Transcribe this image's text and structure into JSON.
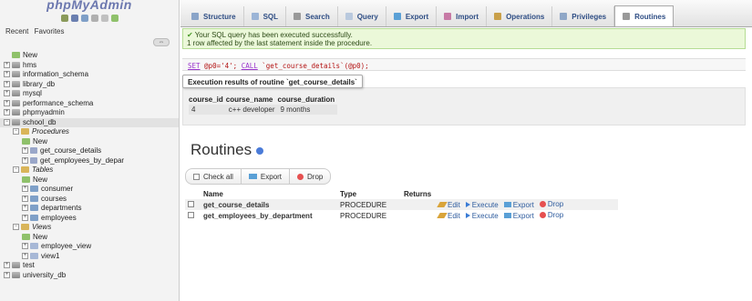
{
  "sidebar": {
    "logo": "phpMyAdmin",
    "recent_label": "Recent",
    "favorites_label": "Favorites",
    "tree": [
      {
        "label": "New",
        "depth": 0,
        "icon": "new-icon",
        "italic": false
      },
      {
        "label": "hms",
        "depth": 0,
        "icon": "database-icon",
        "italic": false
      },
      {
        "label": "information_schema",
        "depth": 0,
        "icon": "database-icon",
        "italic": false
      },
      {
        "label": "library_db",
        "depth": 0,
        "icon": "database-icon",
        "italic": false
      },
      {
        "label": "mysql",
        "depth": 0,
        "icon": "database-icon",
        "italic": false
      },
      {
        "label": "performance_schema",
        "depth": 0,
        "icon": "database-icon",
        "italic": false
      },
      {
        "label": "phpmyadmin",
        "depth": 0,
        "icon": "database-icon",
        "italic": false
      },
      {
        "label": "school_db",
        "depth": 0,
        "icon": "database-icon",
        "italic": false
      },
      {
        "label": "Procedures",
        "depth": 1,
        "icon": "folder-icon",
        "italic": true
      },
      {
        "label": "New",
        "depth": 2,
        "icon": "new-icon",
        "italic": false
      },
      {
        "label": "get_course_details",
        "depth": 2,
        "icon": "procedure-icon",
        "italic": false
      },
      {
        "label": "get_employees_by_depar",
        "depth": 2,
        "icon": "procedure-icon",
        "italic": false
      },
      {
        "label": "Tables",
        "depth": 1,
        "icon": "folder-icon",
        "italic": true
      },
      {
        "label": "New",
        "depth": 2,
        "icon": "new-icon",
        "italic": false
      },
      {
        "label": "consumer",
        "depth": 2,
        "icon": "table-icon",
        "italic": false
      },
      {
        "label": "courses",
        "depth": 2,
        "icon": "table-icon",
        "italic": false
      },
      {
        "label": "departments",
        "depth": 2,
        "icon": "table-icon",
        "italic": false
      },
      {
        "label": "employees",
        "depth": 2,
        "icon": "table-icon",
        "italic": false
      },
      {
        "label": "Views",
        "depth": 1,
        "icon": "folder-icon",
        "italic": true
      },
      {
        "label": "New",
        "depth": 2,
        "icon": "new-icon",
        "italic": false
      },
      {
        "label": "employee_view",
        "depth": 2,
        "icon": "view-icon",
        "italic": false
      },
      {
        "label": "view1",
        "depth": 2,
        "icon": "view-icon",
        "italic": false
      },
      {
        "label": "test",
        "depth": 0,
        "icon": "database-icon",
        "italic": false
      },
      {
        "label": "university_db",
        "depth": 0,
        "icon": "database-icon",
        "italic": false
      }
    ]
  },
  "tabs": [
    {
      "label": "Structure",
      "icon": "structure-icon",
      "color": "#8aa4c8"
    },
    {
      "label": "SQL",
      "icon": "sql-icon",
      "color": "#9bb4d6"
    },
    {
      "label": "Search",
      "icon": "search-icon",
      "color": "#999999"
    },
    {
      "label": "Query",
      "icon": "query-icon",
      "color": "#b9c9de"
    },
    {
      "label": "Export",
      "icon": "export-icon",
      "color": "#5aa0d6"
    },
    {
      "label": "Import",
      "icon": "import-icon",
      "color": "#c77aa5"
    },
    {
      "label": "Operations",
      "icon": "wrench-icon",
      "color": "#c9a04a"
    },
    {
      "label": "Privileges",
      "icon": "privileges-icon",
      "color": "#8fa7c7"
    },
    {
      "label": "Routines",
      "icon": "routines-icon",
      "color": "#999999"
    }
  ],
  "success": {
    "line1": "Your SQL query has been executed successfully.",
    "line2": "1 row affected by the last statement inside the procedure."
  },
  "sql": {
    "set_kw": "SET",
    "set_rest": " @p0='4'; ",
    "call_kw": "CALL",
    "call_rest": " `get_course_details`(@p0);"
  },
  "execution": {
    "title": "Execution results of routine `get_course_details`",
    "headers": [
      "course_id",
      "course_name",
      "course_duration"
    ],
    "rows": [
      [
        "4",
        "c++ developer",
        "9 months"
      ]
    ]
  },
  "routines": {
    "heading": "Routines",
    "check_all": "Check all",
    "export": "Export",
    "drop": "Drop",
    "headers": [
      "Name",
      "Type",
      "Returns"
    ],
    "rows": [
      {
        "name": "get_course_details",
        "type": "PROCEDURE",
        "returns": ""
      },
      {
        "name": "get_employees_by_department",
        "type": "PROCEDURE",
        "returns": ""
      }
    ],
    "actions": {
      "edit": "Edit",
      "execute": "Execute",
      "export": "Export",
      "drop": "Drop"
    }
  }
}
